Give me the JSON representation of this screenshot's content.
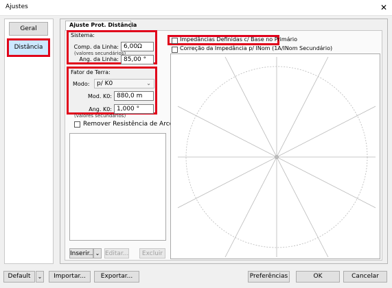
{
  "window": {
    "title": "Ajustes",
    "close_glyph": "✕"
  },
  "sidebar": {
    "items": [
      {
        "label": "Geral"
      },
      {
        "label": "Distância",
        "selected": true
      }
    ]
  },
  "tab": {
    "label": "Ajuste Prot. Distância"
  },
  "sistema": {
    "legend": "Sistema:",
    "comp_label": "Comp. da Linha:",
    "comp_value": "6,00Ω",
    "note": "(valores secundários)",
    "ang_label": "Ang. da Linha:",
    "ang_value": "85,00 °"
  },
  "fator_terra": {
    "legend": "Fator de Terra:",
    "modo_label": "Modo:",
    "modo_value": "p/ K0",
    "mod_label": "Mod. K0:",
    "mod_value": "880,0 m",
    "ang_label": "Ang. K0:",
    "ang_value": "1,000 °",
    "note": "(valores secundários)"
  },
  "remover": {
    "label": "Remover Resistência de Arco",
    "checked": false
  },
  "list_buttons": {
    "inserir": "Inserir...",
    "editar": "Editar...",
    "excluir": "Excluir"
  },
  "options": [
    {
      "label": "Impedâncias Definidas c/ Base no Primário",
      "checked": false
    },
    {
      "label": "Correção da Impedância p/ INom (1A/INom Secundário)",
      "checked": false
    }
  ],
  "footer": {
    "default": "Default",
    "importar": "Importar...",
    "exportar": "Exportar...",
    "preferencias": "Preferências",
    "ok": "OK",
    "cancelar": "Cancelar"
  },
  "colors": {
    "highlight": "#e0001a",
    "selected_item": "#cce8ff"
  }
}
